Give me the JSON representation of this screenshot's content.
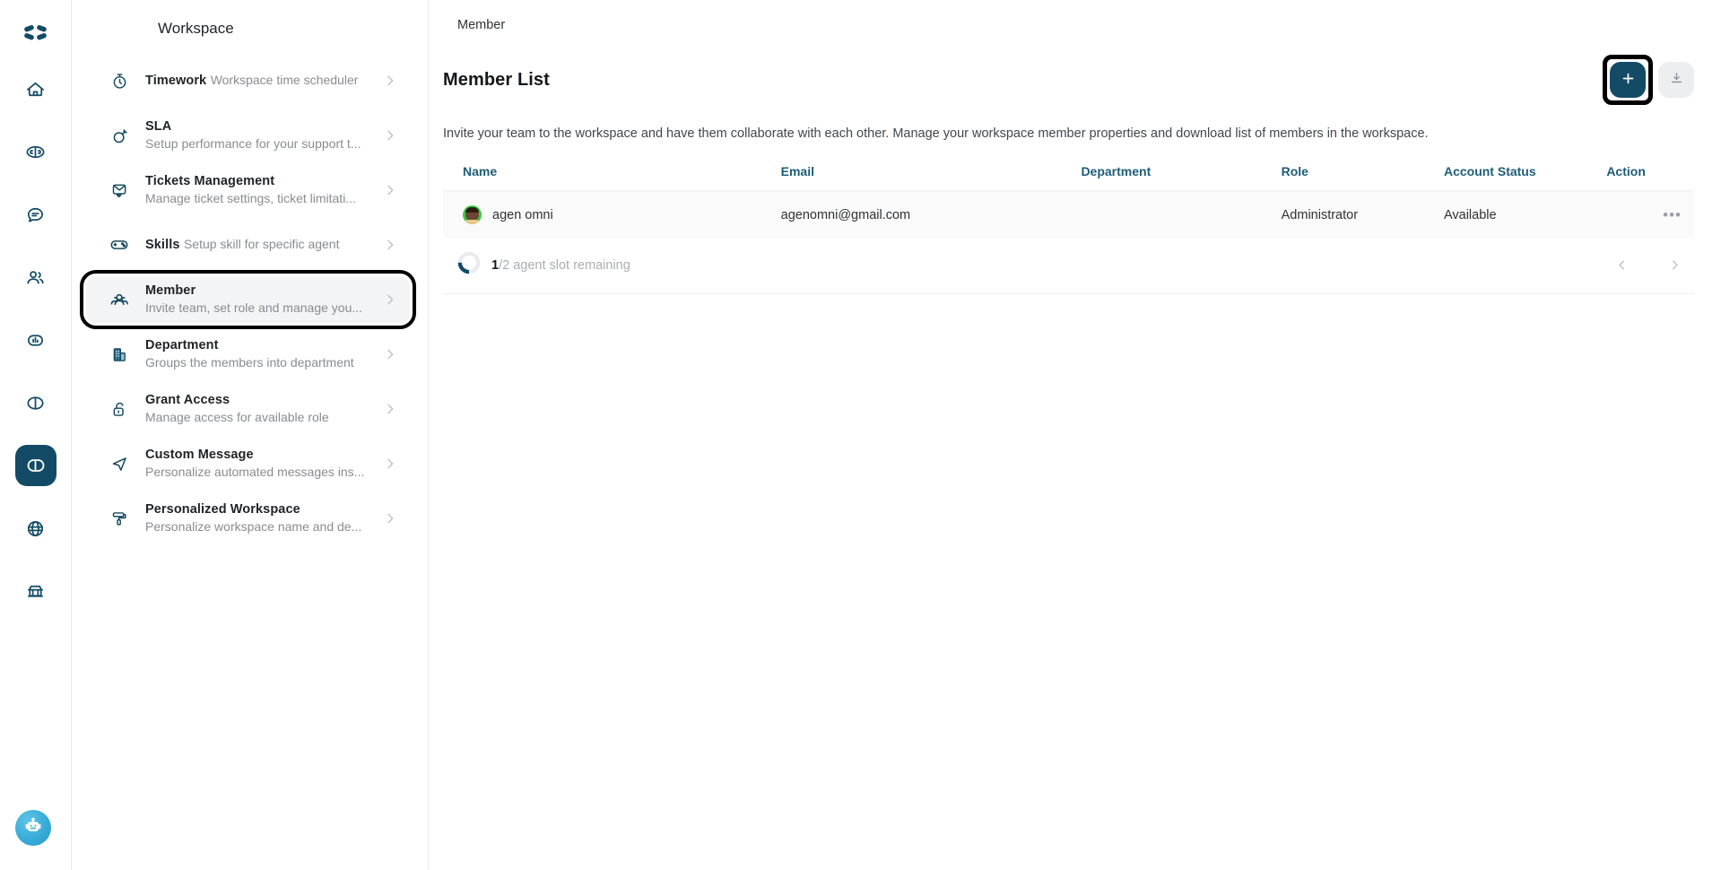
{
  "rail": {
    "logo_name": "app-logo",
    "active_index": 6,
    "items": [
      {
        "icon": "home-icon",
        "label": "Home"
      },
      {
        "icon": "inbox-icon",
        "label": "Inbox"
      },
      {
        "icon": "chat-icon",
        "label": "Chat"
      },
      {
        "icon": "contacts-icon",
        "label": "Contacts"
      },
      {
        "icon": "analytics-icon",
        "label": "Analytics"
      },
      {
        "icon": "workspace-icon",
        "label": "Workspace"
      },
      {
        "icon": "globe-icon",
        "label": "Channels"
      },
      {
        "icon": "marketplace-icon",
        "label": "Marketplace"
      }
    ],
    "bot_label": "Chatbot Assistant"
  },
  "panel": {
    "title": "Workspace",
    "items": [
      {
        "title": "Timework",
        "subtitle": "Workspace time scheduler",
        "icon": "stopwatch-icon"
      },
      {
        "title": "SLA",
        "subtitle": "Setup performance for your support t...",
        "icon": "target-icon"
      },
      {
        "title": "Tickets Management",
        "subtitle": "Manage ticket settings, ticket limitati...",
        "icon": "ticket-envelope-icon"
      },
      {
        "title": "Skills",
        "subtitle": "Setup skill for specific agent",
        "icon": "gamepad-icon"
      },
      {
        "title": "Member",
        "subtitle": "Invite team, set role and manage you...",
        "icon": "people-icon"
      },
      {
        "title": "Department",
        "subtitle": "Groups the members into department",
        "icon": "building-icon"
      },
      {
        "title": "Grant Access",
        "subtitle": "Manage access for available role",
        "icon": "unlock-icon"
      },
      {
        "title": "Custom Message",
        "subtitle": "Personalize automated messages ins...",
        "icon": "send-icon"
      },
      {
        "title": "Personalized Workspace",
        "subtitle": "Personalize workspace name and de...",
        "icon": "paint-roller-icon"
      }
    ],
    "selected_index": 4
  },
  "main": {
    "breadcrumb": "Member",
    "page_title": "Member List",
    "description": "Invite your team to the workspace and have them collaborate with each other. Manage your workspace member properties and download list of members in the workspace.",
    "add_button_label": "+",
    "add_button_name": "plus-icon",
    "download_button_name": "download-icon",
    "table": {
      "headers": [
        "Name",
        "Email",
        "Department",
        "Role",
        "Account Status",
        "Action"
      ],
      "rows": [
        {
          "name": "agen omni",
          "email": "agenomni@gmail.com",
          "department": "",
          "role": "Administrator",
          "status": "Available",
          "action": "•••"
        }
      ]
    },
    "footer": {
      "slot_used": "1",
      "slot_rest": "/2 agent slot remaining",
      "slot_percent": 50,
      "prev_label": "‹",
      "next_label": "›"
    }
  },
  "colors": {
    "accent": "#134b66",
    "header_text": "#1d5c78",
    "muted": "#868d94",
    "row_bg": "#fafafa",
    "avatar_bg": "#3cc84a"
  }
}
